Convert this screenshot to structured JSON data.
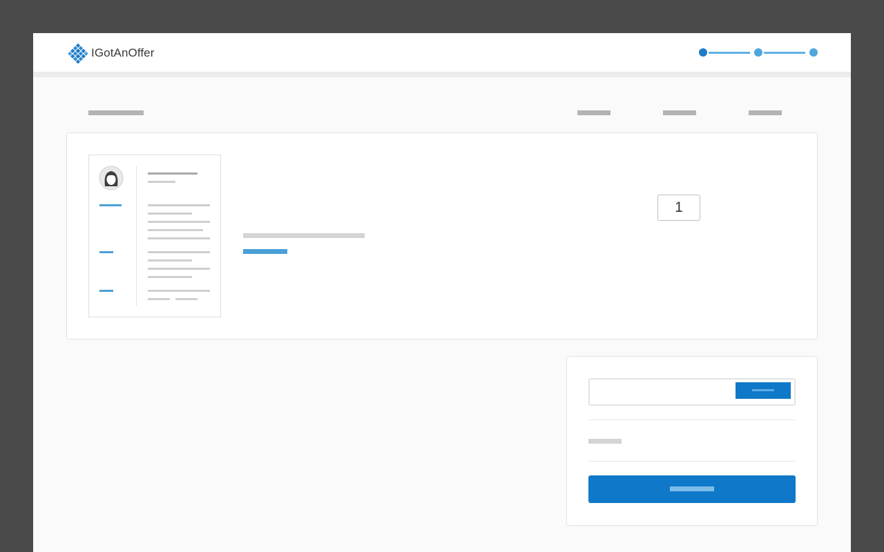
{
  "app": {
    "brand": "IGotAnOffer",
    "brand_icon": "diamond-grid-logo-icon",
    "colors": {
      "accent": "#0f78c8",
      "accent_light": "#4ea6dd",
      "background": "#fafafa",
      "frame": "#4a4a4a"
    }
  },
  "progress": {
    "steps": 3,
    "current_step": 1
  },
  "cart": {
    "item": {
      "thumbnail_icon": "resume-document-icon",
      "avatar_icon": "user-avatar-icon",
      "quantity": "1"
    }
  }
}
